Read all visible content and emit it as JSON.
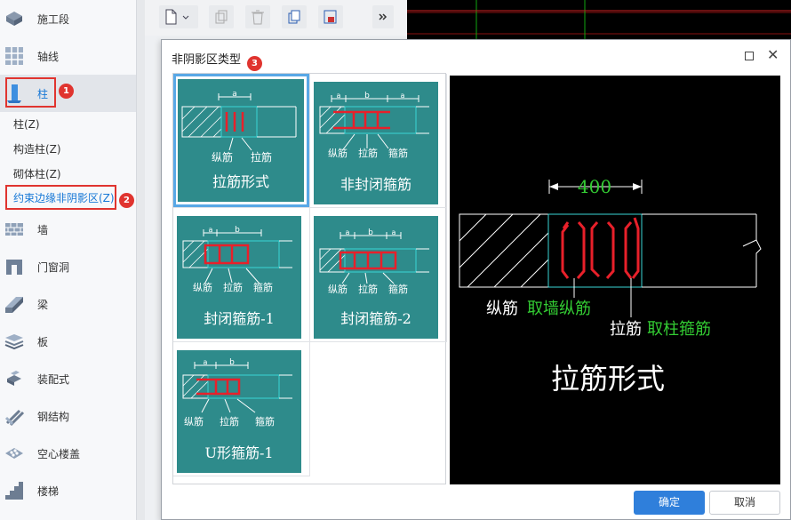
{
  "sidebar": {
    "items": [
      {
        "label": "施工段",
        "icon": "construction-segment-icon"
      },
      {
        "label": "轴线",
        "icon": "axis-grid-icon"
      },
      {
        "label": "柱",
        "icon": "column-icon"
      },
      {
        "label": "墙",
        "icon": "wall-icon"
      },
      {
        "label": "门窗洞",
        "icon": "door-window-icon"
      },
      {
        "label": "梁",
        "icon": "beam-icon"
      },
      {
        "label": "板",
        "icon": "slab-icon"
      },
      {
        "label": "装配式",
        "icon": "prefab-icon"
      },
      {
        "label": "钢结构",
        "icon": "steel-structure-icon"
      },
      {
        "label": "空心楼盖",
        "icon": "hollow-floor-icon"
      },
      {
        "label": "楼梯",
        "icon": "stair-icon"
      }
    ],
    "sub_items": [
      "柱(Z)",
      "构造柱(Z)",
      "砌体柱(Z)",
      "约束边缘非阴影区(Z)"
    ]
  },
  "annotations": [
    "1",
    "2",
    "3"
  ],
  "toolbar": {
    "icons": [
      "new-file-icon",
      "copy-icon",
      "delete-icon",
      "duplicate-icon",
      "layer-icon",
      "more-icon"
    ]
  },
  "dialog": {
    "title": "非阴影区类型",
    "options": [
      {
        "label": "拉筋形式",
        "selected": true,
        "parts": [
          "纵筋",
          "拉筋"
        ],
        "dims": [
          "a"
        ]
      },
      {
        "label": "非封闭箍筋",
        "selected": false,
        "parts": [
          "纵筋",
          "拉筋",
          "箍筋"
        ],
        "dims": [
          "a",
          "b",
          "a"
        ]
      },
      {
        "label": "封闭箍筋-1",
        "selected": false,
        "parts": [
          "纵筋",
          "拉筋",
          "箍筋"
        ],
        "dims": [
          "a",
          "b"
        ]
      },
      {
        "label": "封闭箍筋-2",
        "selected": false,
        "parts": [
          "纵筋",
          "拉筋",
          "箍筋"
        ],
        "dims": [
          "a",
          "b",
          "a"
        ]
      },
      {
        "label": "U形箍筋-1",
        "selected": false,
        "parts": [
          "纵筋",
          "拉筋",
          "箍筋"
        ],
        "dims": [
          "a",
          "b"
        ]
      }
    ],
    "preview": {
      "dimension": "400",
      "label1": "纵筋",
      "label1_green": "取墙纵筋",
      "label2": "拉筋",
      "label2_green": "取柱箍筋",
      "caption": "拉筋形式"
    },
    "ok_label": "确定",
    "cancel_label": "取消"
  },
  "colors": {
    "accent": "#2f7fdb",
    "card": "#2e8b8b",
    "highlight": "#e0342f",
    "green_text": "#33cc33"
  }
}
